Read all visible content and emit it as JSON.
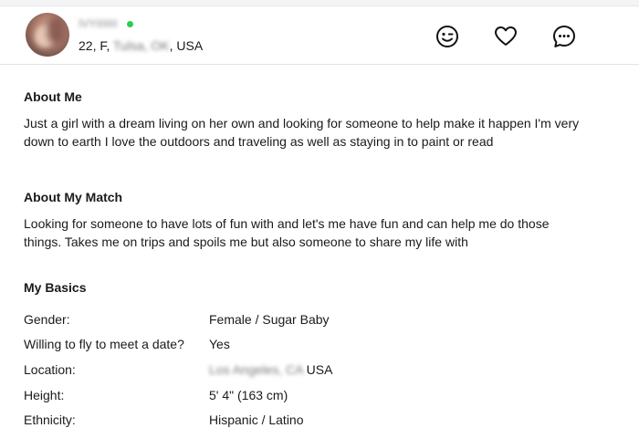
{
  "header": {
    "username": "IVYIIIIIII",
    "age_gender": "22, F,",
    "city": "Tulsa, OK",
    "country": ", USA",
    "icons": [
      "wink-icon",
      "heart-icon",
      "chat-icon"
    ]
  },
  "about_me": {
    "title": "About Me",
    "text": "Just a girl with a dream living on her own and looking for someone to help make it happen I'm very down to earth I love the outdoors and traveling as well as staying in to paint or read"
  },
  "about_match": {
    "title": "About My Match",
    "text": "Looking for someone to have lots of fun with and let's me have fun and can help me do those things. Takes me on trips and spoils me but also someone to share my life with"
  },
  "basics": {
    "title": "My Basics",
    "rows": [
      {
        "label": "Gender:",
        "value": "Female / Sugar Baby"
      },
      {
        "label": "Willing to fly to meet a date?",
        "value": "Yes"
      },
      {
        "label": "Location:",
        "value_blurred": "Los Angeles, CA",
        "value": "USA"
      },
      {
        "label": "Height:",
        "value": "5' 4\" (163 cm)"
      },
      {
        "label": "Ethnicity:",
        "value": "Hispanic / Latino"
      }
    ]
  },
  "colors": {
    "online": "#2ecc52",
    "text": "#1a1a1a",
    "divider": "#e3e3e3"
  }
}
